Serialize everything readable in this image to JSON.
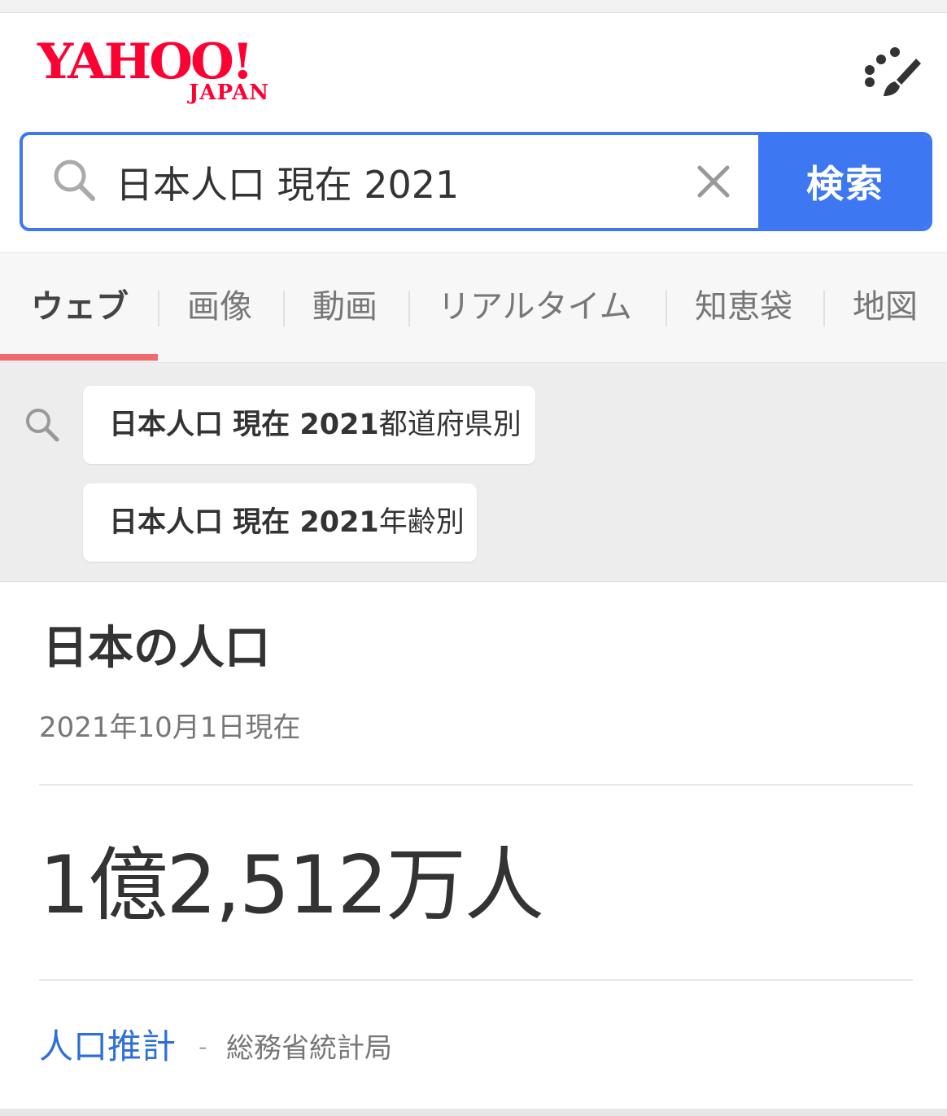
{
  "logo": {
    "main": "YAHOO!",
    "sub": "JAPAN"
  },
  "search": {
    "query": "日本人口 現在 2021",
    "button_label": "検索"
  },
  "tabs": [
    {
      "label": "ウェブ",
      "active": true
    },
    {
      "label": "画像",
      "active": false
    },
    {
      "label": "動画",
      "active": false
    },
    {
      "label": "リアルタイム",
      "active": false
    },
    {
      "label": "知恵袋",
      "active": false
    },
    {
      "label": "地図",
      "active": false
    }
  ],
  "suggestions": [
    {
      "bold": "日本人口 現在 2021",
      "rest": "都道府県別"
    },
    {
      "bold": "日本人口 現在 2021",
      "rest": "年齢別"
    }
  ],
  "card": {
    "title": "日本の人口",
    "date": "2021年10月1日現在",
    "population": "1億2,512万人",
    "source_link": "人口推計",
    "source_separator": "-",
    "source_org": "総務省統計局"
  },
  "colors": {
    "brand": "#ff0033",
    "accent": "#3d78f2",
    "tab_underline": "#f06a6a",
    "link": "#2e6fd8"
  },
  "icons": {
    "theme": "palette-brush-icon",
    "search": "search-icon",
    "clear": "close-icon"
  }
}
